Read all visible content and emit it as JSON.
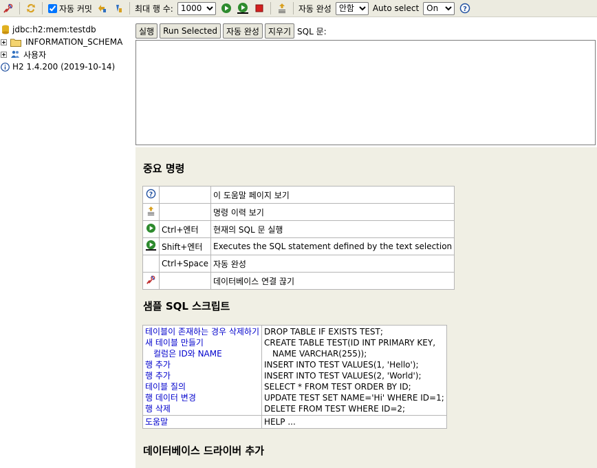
{
  "toolbar": {
    "auto_commit_label": "자동 커밋",
    "auto_commit_checked": true,
    "max_rows_label": "최대 행 수:",
    "max_rows_value": "1000",
    "auto_complete_label": "자동 완성",
    "auto_complete_value": "안함",
    "auto_select_label": "Auto select",
    "auto_select_value": "On"
  },
  "tree": {
    "items": [
      {
        "label": "jdbc:h2:mem:testdb",
        "icon": "database-icon"
      },
      {
        "label": "INFORMATION_SCHEMA",
        "icon": "folder-icon"
      },
      {
        "label": "사용자",
        "icon": "users-icon"
      },
      {
        "label": "H2 1.4.200 (2019-10-14)",
        "icon": "info-icon"
      }
    ]
  },
  "query": {
    "buttons": [
      "실행",
      "Run Selected",
      "자동 완성",
      "지우기"
    ],
    "sql_label": "SQL 문:",
    "sql_value": ""
  },
  "help": {
    "important_title": "중요 명령",
    "commands": [
      {
        "icon": "help-icon",
        "key": "",
        "desc": "이 도움말 페이지 보기"
      },
      {
        "icon": "history-icon",
        "key": "",
        "desc": "명령 이력 보기"
      },
      {
        "icon": "run-icon",
        "key": "Ctrl+엔터",
        "desc": "현재의 SQL 문 실행"
      },
      {
        "icon": "run-selected-icon",
        "key": "Shift+엔터",
        "desc": "Executes the SQL statement defined by the text selection"
      },
      {
        "icon": "",
        "key": "Ctrl+Space",
        "desc": "자동 완성"
      },
      {
        "icon": "disconnect-icon",
        "key": "",
        "desc": "데이터베이스 연결 끊기"
      }
    ],
    "samples_title": "샘플 SQL 스크립트",
    "samples_links": [
      "테이블이 존재하는 경우 삭제하기",
      "새 테이블 만들기",
      "컬럼은 ID와 NAME",
      "행 추가",
      "행 추가",
      "테이블 질의",
      "행 데이터 변경",
      "행 삭제"
    ],
    "samples_code": [
      "DROP TABLE IF EXISTS TEST;",
      "CREATE TABLE TEST(ID INT PRIMARY KEY,",
      "NAME VARCHAR(255));",
      "INSERT INTO TEST VALUES(1, 'Hello');",
      "INSERT INTO TEST VALUES(2, 'World');",
      "SELECT * FROM TEST ORDER BY ID;",
      "UPDATE TEST SET NAME='Hi' WHERE ID=1;",
      "DELETE FROM TEST WHERE ID=2;"
    ],
    "help_link": "도움말",
    "help_code": "HELP ...",
    "drivers_title": "데이터베이스 드라이버 추가"
  },
  "colors": {
    "toolbar_bg": "#ecebe0",
    "panel_bg": "#f0efe4",
    "link": "#0000cc",
    "run_green": "#2e8b2e",
    "stop_red": "#d42020"
  }
}
